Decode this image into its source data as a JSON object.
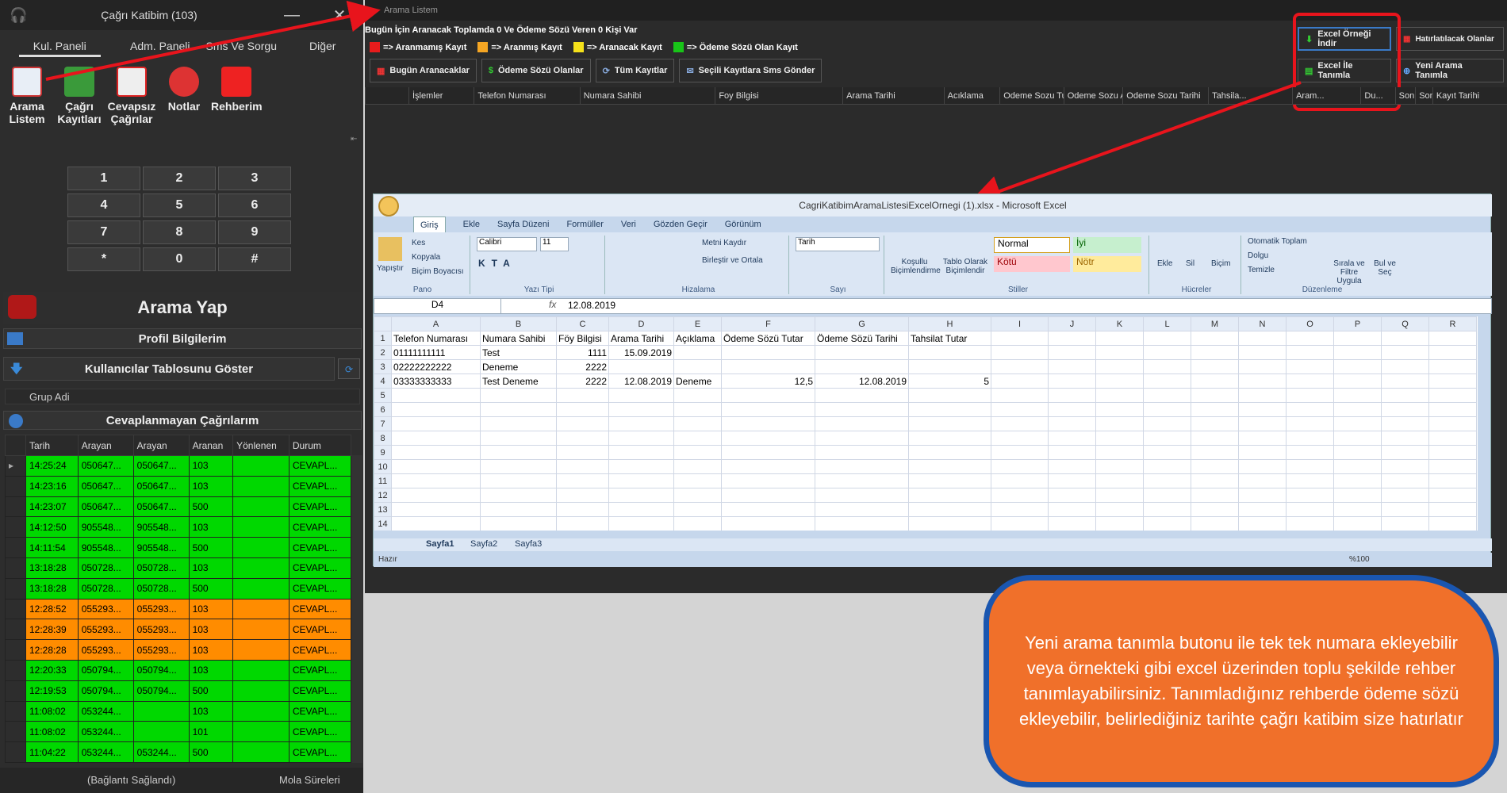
{
  "left_app": {
    "title": "Çağrı Katibim (103)",
    "minimize": "—",
    "close": "✕",
    "tabs": [
      "Kul. Paneli",
      "Adm. Paneli",
      "Sms Ve Sorgu",
      "Diğer"
    ],
    "icons": [
      {
        "label": "Arama Listem",
        "icon": "list-icon"
      },
      {
        "label": "Çağrı Kayıtları",
        "icon": "records-icon"
      },
      {
        "label": "Cevapsız Çağrılar",
        "icon": "missed-call-icon"
      },
      {
        "label": "Notlar",
        "icon": "alarm-clock-icon"
      },
      {
        "label": "Rehberim",
        "icon": "phonebook-icon"
      }
    ],
    "keys": [
      "1",
      "2",
      "3",
      "4",
      "5",
      "6",
      "7",
      "8",
      "9",
      "*",
      "0",
      "#"
    ],
    "call_button": "Arama Yap",
    "profile": "Profil Bilgilerim",
    "show_users": "Kullanıcılar Tablosunu Göster",
    "group_name": "Grup Adi",
    "unanswered": "Cevaplanmayan Çağrılarım",
    "table_headers": [
      "Tarih",
      "Arayan",
      "Arayan",
      "Aranan",
      "Yönlenen",
      "Durum"
    ],
    "rows": [
      {
        "t": "14:25:24",
        "a1": "050647...",
        "a2": "050647...",
        "ar": "103",
        "y": "",
        "d": "CEVAPL...",
        "c": "g"
      },
      {
        "t": "14:23:16",
        "a1": "050647...",
        "a2": "050647...",
        "ar": "103",
        "y": "",
        "d": "CEVAPL...",
        "c": "g"
      },
      {
        "t": "14:23:07",
        "a1": "050647...",
        "a2": "050647...",
        "ar": "500",
        "y": "",
        "d": "CEVAPL...",
        "c": "g"
      },
      {
        "t": "14:12:50",
        "a1": "905548...",
        "a2": "905548...",
        "ar": "103",
        "y": "",
        "d": "CEVAPL...",
        "c": "g"
      },
      {
        "t": "14:11:54",
        "a1": "905548...",
        "a2": "905548...",
        "ar": "500",
        "y": "",
        "d": "CEVAPL...",
        "c": "g"
      },
      {
        "t": "13:18:28",
        "a1": "050728...",
        "a2": "050728...",
        "ar": "103",
        "y": "",
        "d": "CEVAPL...",
        "c": "g"
      },
      {
        "t": "13:18:28",
        "a1": "050728...",
        "a2": "050728...",
        "ar": "500",
        "y": "",
        "d": "CEVAPL...",
        "c": "g"
      },
      {
        "t": "12:28:52",
        "a1": "055293...",
        "a2": "055293...",
        "ar": "103",
        "y": "",
        "d": "CEVAPL...",
        "c": "o"
      },
      {
        "t": "12:28:39",
        "a1": "055293...",
        "a2": "055293...",
        "ar": "103",
        "y": "",
        "d": "CEVAPL...",
        "c": "o"
      },
      {
        "t": "12:28:28",
        "a1": "055293...",
        "a2": "055293...",
        "ar": "103",
        "y": "",
        "d": "CEVAPL...",
        "c": "o"
      },
      {
        "t": "12:20:33",
        "a1": "050794...",
        "a2": "050794...",
        "ar": "103",
        "y": "",
        "d": "CEVAPL...",
        "c": "g"
      },
      {
        "t": "12:19:53",
        "a1": "050794...",
        "a2": "050794...",
        "ar": "500",
        "y": "",
        "d": "CEVAPL...",
        "c": "g"
      },
      {
        "t": "11:08:02",
        "a1": "053244...",
        "a2": "",
        "ar": "103",
        "y": "",
        "d": "CEVAPL...",
        "c": "g"
      },
      {
        "t": "11:08:02",
        "a1": "053244...",
        "a2": "",
        "ar": "101",
        "y": "",
        "d": "CEVAPL...",
        "c": "g"
      },
      {
        "t": "11:04:22",
        "a1": "053244...",
        "a2": "053244...",
        "ar": "500",
        "y": "",
        "d": "CEVAPL...",
        "c": "g"
      }
    ],
    "status": "(Bağlantı Sağlandı)",
    "breaks": "Mola Süreleri"
  },
  "right_app": {
    "title": "Arama Listem",
    "info": "Bugün İçin Aranacak Toplamda 0 Ve Ödeme Sözü Veren 0 Kişi Var",
    "legend": [
      {
        "color": "#e81c1c",
        "label": "=> Aranmamış Kayıt"
      },
      {
        "color": "#f5a623",
        "label": "=> Aranmış Kayıt"
      },
      {
        "color": "#f5e11a",
        "label": "=> Aranacak Kayıt"
      },
      {
        "color": "#18c418",
        "label": "=> Ödeme Sözü Olan Kayıt"
      }
    ],
    "buttons": [
      "Bugün Aranacaklar",
      "Ödeme Sözü Olanlar",
      "Tüm Kayıtlar",
      "Seçili Kayıtlara Sms Gönder"
    ],
    "right_buttons": [
      "Excel Örneği İndir",
      "Hatırlatılacak Olanlar",
      "Excel İle Tanımla",
      "Yeni Arama Tanımla"
    ],
    "columns": [
      "İşlemler",
      "Telefon Numarası",
      "Numara Sahibi",
      "Foy Bilgisi",
      "Arama Tarihi",
      "Acıklama",
      "Odeme Sozu Tutar",
      "Odeme Sozu Alindi Mi",
      "Odeme Sozu Tarihi",
      "Tahsila...",
      "Aram...",
      "Du...",
      "Son Arama Tarihi",
      "Son Islem Tarihi",
      "Kayıt Tarihi"
    ]
  },
  "excel": {
    "title": "CagriKatibimAramaListesiExcelOrnegi (1).xlsx - Microsoft Excel",
    "tabs": [
      "Giriş",
      "Ekle",
      "Sayfa Düzeni",
      "Formüller",
      "Veri",
      "Gözden Geçir",
      "Görünüm"
    ],
    "ribbon": {
      "paste": "Yapıştır",
      "cut": "Kes",
      "copy": "Kopyala",
      "painter": "Biçim Boyacısı",
      "pano": "Pano",
      "font": "Calibri",
      "size": "11",
      "font_group": "Yazı Tipi",
      "wrap": "Metni Kaydır",
      "merge": "Birleştir ve Ortala",
      "align_group": "Hizalama",
      "num_format": "Tarih",
      "num_group": "Sayı",
      "cond": "Koşullu Biçimlendirme",
      "table": "Tablo Olarak Biçimlendir",
      "normal": "Normal",
      "good": "İyi",
      "bad": "Kötü",
      "neutral": "Nötr",
      "styles_group": "Stiller",
      "insert": "Ekle",
      "delete": "Sil",
      "format": "Biçim",
      "cells_group": "Hücreler",
      "autosum": "Otomatik Toplam",
      "fill": "Dolgu",
      "clear": "Temizle",
      "sort": "Sırala ve Filtre Uygula",
      "find": "Bul ve Seç",
      "edit_group": "Düzenleme"
    },
    "name_box": "D4",
    "formula": "12.08.2019",
    "col_headers": [
      "A",
      "B",
      "C",
      "D",
      "E",
      "F",
      "G",
      "H",
      "I",
      "J",
      "K",
      "L",
      "M",
      "N",
      "O",
      "P",
      "Q",
      "R"
    ],
    "rows": [
      [
        "Telefon Numarası",
        "Numara Sahibi",
        "Föy Bilgisi",
        "Arama Tarihi",
        "Açıklama",
        "Ödeme Sözü Tutar",
        "Ödeme Sözü Tarihi",
        "Tahsilat Tutar"
      ],
      [
        "01111111111",
        "Test",
        "1111",
        "15.09.2019",
        "",
        "",
        "",
        ""
      ],
      [
        "02222222222",
        "Deneme",
        "2222",
        "",
        "",
        "",
        "",
        ""
      ],
      [
        "03333333333",
        "Test Deneme",
        "2222",
        "12.08.2019",
        "Deneme",
        "12,5",
        "12.08.2019",
        "5"
      ]
    ],
    "row_count": 14,
    "sheets": [
      "Sayfa1",
      "Sayfa2",
      "Sayfa3"
    ],
    "status": "Hazır",
    "zoom": "%100"
  },
  "callout": "Yeni arama tanımla butonu ile tek tek numara ekleyebilir veya örnekteki gibi excel üzerinden toplu şekilde rehber tanımlayabilirsiniz. Tanımladığınız rehberde ödeme sözü ekleyebilir, belirlediğiniz tarihte çağrı katibim size hatırlatır"
}
